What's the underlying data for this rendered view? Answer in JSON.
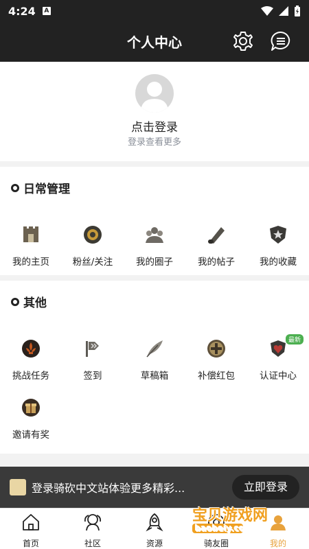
{
  "statusbar": {
    "time": "4:24",
    "app_badge": "A"
  },
  "header": {
    "title": "个人中心",
    "settings_icon": "gear-icon",
    "messages_icon": "chat-bubble-icon"
  },
  "profile": {
    "login_text": "点击登录",
    "login_subtext": "登录查看更多"
  },
  "daily": {
    "title": "日常管理",
    "items": [
      {
        "label": "我的主页",
        "icon": "castle-icon"
      },
      {
        "label": "粉丝/关注",
        "icon": "medal-icon"
      },
      {
        "label": "我的圈子",
        "icon": "group-icon"
      },
      {
        "label": "我的帖子",
        "icon": "scroll-icon"
      },
      {
        "label": "我的收藏",
        "icon": "star-shield-icon"
      }
    ]
  },
  "other": {
    "title": "其他",
    "items": [
      {
        "label": "挑战任务",
        "icon": "fleur-icon"
      },
      {
        "label": "签到",
        "icon": "flag-icon"
      },
      {
        "label": "草稿箱",
        "icon": "quill-icon"
      },
      {
        "label": "补偿红包",
        "icon": "plus-coin-icon"
      },
      {
        "label": "认证中心",
        "icon": "heart-shield-icon",
        "badge": "最新"
      },
      {
        "label": "邀请有奖",
        "icon": "gift-icon"
      }
    ]
  },
  "banner": {
    "text": "登录骑砍中文站体验更多精彩...",
    "button": "立即登录"
  },
  "tabs": [
    {
      "label": "首页",
      "icon": "home-icon"
    },
    {
      "label": "社区",
      "icon": "community-icon"
    },
    {
      "label": "资源",
      "icon": "rocket-icon"
    },
    {
      "label": "骑友圈",
      "icon": "circle-icon"
    },
    {
      "label": "我的",
      "icon": "profile-icon"
    }
  ],
  "watermark": {
    "text": "宝贝游戏网",
    "domain": "baobeiy.com"
  },
  "colors": {
    "topbar": "#222222",
    "active_tab": "#e8a23c",
    "badge": "#4caf50"
  }
}
